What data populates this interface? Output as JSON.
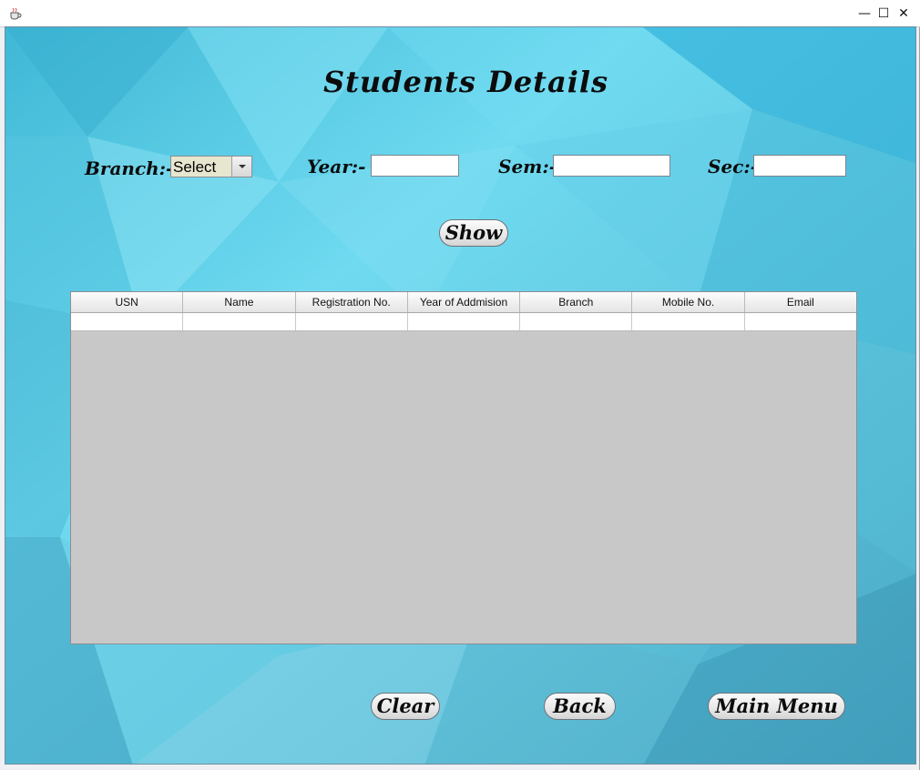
{
  "window": {
    "minimize_glyph": "—",
    "maximize_glyph": "☐",
    "close_glyph": "✕"
  },
  "form": {
    "title": "Students Details",
    "branch_label": "Branch:-",
    "branch_selected": "Select",
    "year_label": "Year:-",
    "year_value": "",
    "sem_label": "Sem:-",
    "sem_value": "",
    "sec_label": "Sec:-",
    "sec_value": "",
    "show_button": "Show"
  },
  "table": {
    "columns": [
      "USN",
      "Name",
      "Registration No.",
      "Year of Addmision",
      "Branch",
      "Mobile No.",
      "Email"
    ],
    "rows": [
      [
        "",
        "",
        "",
        "",
        "",
        "",
        ""
      ]
    ]
  },
  "footer": {
    "clear_button": "Clear",
    "back_button": "Back",
    "main_menu_button": "Main Menu"
  },
  "colors": {
    "accent_cyan": "#5fd3ec",
    "table_empty_area": "#c8c8c8"
  },
  "icons": {
    "app": "java-coffee-cup-icon",
    "minimize": "minimize-icon",
    "maximize": "maximize-icon",
    "close": "close-icon",
    "dropdown": "chevron-down-icon"
  }
}
